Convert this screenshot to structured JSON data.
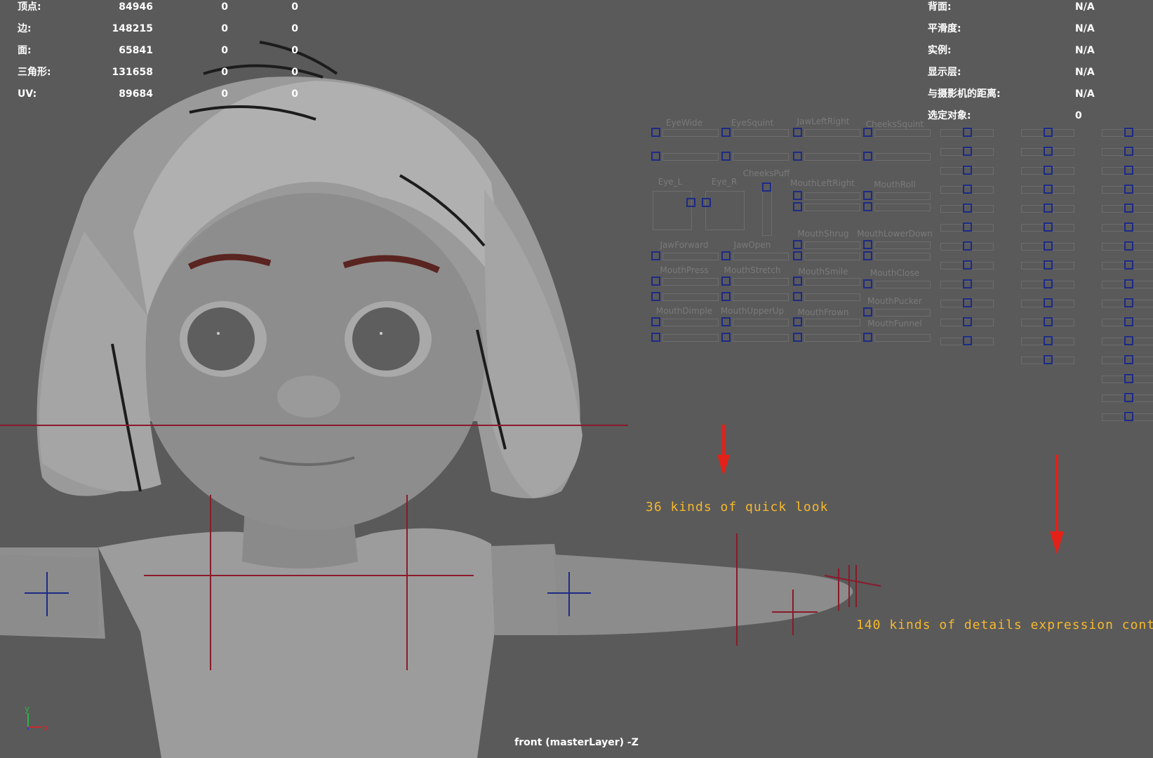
{
  "hud_left": {
    "rows": [
      {
        "label": "顶点:",
        "v1": "84946",
        "v2": "0",
        "v3": "0"
      },
      {
        "label": "边:",
        "v1": "148215",
        "v2": "0",
        "v3": "0"
      },
      {
        "label": "面:",
        "v1": "65841",
        "v2": "0",
        "v3": "0"
      },
      {
        "label": "三角形:",
        "v1": "131658",
        "v2": "0",
        "v3": "0"
      },
      {
        "label": "UV:",
        "v1": "89684",
        "v2": "0",
        "v3": "0"
      }
    ]
  },
  "hud_right": {
    "rows": [
      {
        "label": "背面:",
        "value": "N/A"
      },
      {
        "label": "平滑度:",
        "value": "N/A"
      },
      {
        "label": "实例:",
        "value": "N/A"
      },
      {
        "label": "显示层:",
        "value": "N/A"
      },
      {
        "label": "与摄影机的距离:",
        "value": "N/A"
      },
      {
        "label": "选定对象:",
        "value": "0"
      }
    ]
  },
  "facial_panel": {
    "labels": {
      "eye_wide": "EyeWide",
      "eye_squint": "EyeSquint",
      "jaw_left_right": "JawLeftRight",
      "cheeks_squint": "CheeksSquint",
      "eye_l": "Eye_L",
      "eye_r": "Eye_R",
      "cheeks_puff": "CheeksPuff",
      "mouth_left_right": "MouthLeftRight",
      "mouth_roll": "MouthRoll",
      "jaw_forward": "JawForward",
      "jaw_open": "JawOpen",
      "mouth_shrug": "MouthShrug",
      "mouth_lower_down": "MouthLowerDown",
      "mouth_press": "MouthPress",
      "mouth_stretch": "MouthStretch",
      "mouth_smile": "MouthSmile",
      "mouth_close": "MouthClose",
      "mouth_pucker": "MouthPucker",
      "mouth_dimple": "MouthDimple",
      "mouth_upper_up": "MouthUpperUp",
      "mouth_frown": "MouthFrown",
      "mouth_funnel": "MouthFunnel"
    }
  },
  "annotations": {
    "quick_look": "36 kinds of quick look",
    "details": "140 kinds of details expression control"
  },
  "camera_label": "front (masterLayer) -Z",
  "axis": {
    "y": "y",
    "x": "x"
  },
  "colors": {
    "viewport_bg": "#5a5a5a",
    "controller_blue": "#1d2a86",
    "guide_red": "#8a1a2a",
    "annotation_yellow": "#f5b82e",
    "arrow_red": "#e32119"
  }
}
